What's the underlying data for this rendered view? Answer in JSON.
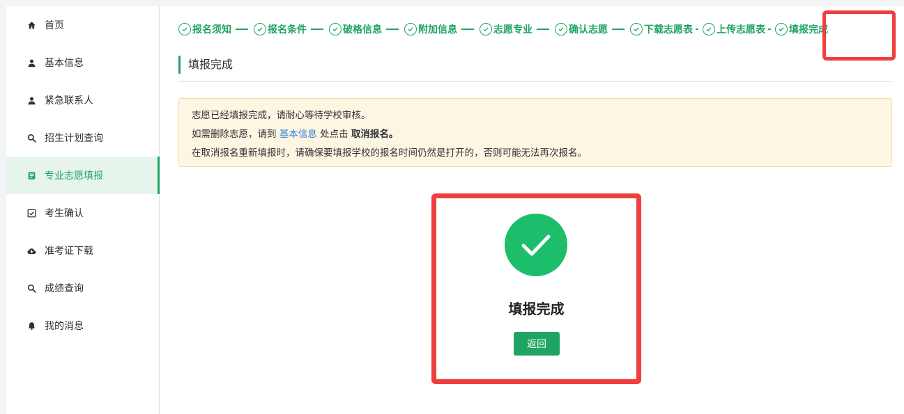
{
  "sidebar": {
    "items": [
      {
        "label": "首页",
        "icon": "home-icon"
      },
      {
        "label": "基本信息",
        "icon": "user-icon"
      },
      {
        "label": "紧急联系人",
        "icon": "user-icon"
      },
      {
        "label": "招生计划查询",
        "icon": "search-icon"
      },
      {
        "label": "专业志愿填报",
        "icon": "document-icon",
        "active": true
      },
      {
        "label": "考生确认",
        "icon": "checkbox-icon"
      },
      {
        "label": "准考证下载",
        "icon": "cloud-download-icon"
      },
      {
        "label": "成绩查询",
        "icon": "search-icon"
      },
      {
        "label": "我的消息",
        "icon": "bell-icon"
      }
    ]
  },
  "steps": [
    "报名须知",
    "报名条件",
    "破格信息",
    "附加信息",
    "志愿专业",
    "确认志愿",
    "下载志愿表",
    "上传志愿表",
    "填报完成"
  ],
  "section_title": "填报完成",
  "notice": {
    "line1": "志愿已经填报完成，请耐心等待学校审核。",
    "line2_prefix": "如需删除志愿，请到",
    "line2_link": "基本信息",
    "line2_middle": "处点击",
    "line2_bold": "取消报名。",
    "line3": "在取消报名重新填报时，请确保要填报学校的报名时间仍然是打开的，否则可能无法再次报名。"
  },
  "result": {
    "title": "填报完成",
    "back_label": "返回"
  },
  "colors": {
    "accent": "#1fa463",
    "success_circle": "#1dbe6b",
    "highlight": "#f03e3e",
    "notice_bg": "#fdf6e3",
    "link": "#2d7fd3"
  }
}
